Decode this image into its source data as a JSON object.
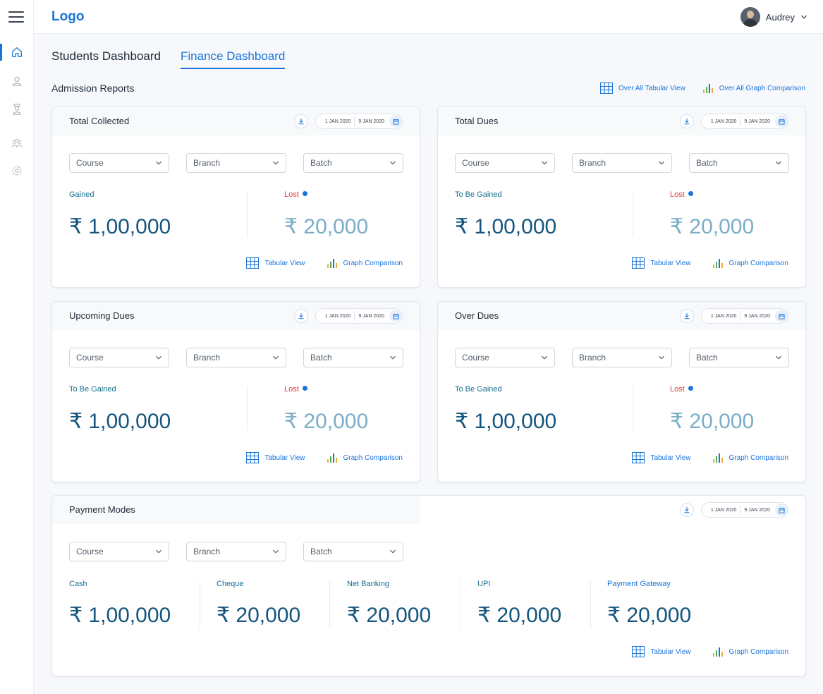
{
  "app": {
    "logo": "Logo",
    "user_name": "Audrey"
  },
  "tabs": [
    "Students Dashboard",
    "Finance Dashboard"
  ],
  "section": {
    "title": "Admission Reports",
    "tabular_all": "Over All Tabular View",
    "graph_all": "Over All Graph Comparison"
  },
  "date_range": {
    "from": "1 JAN 2020",
    "to": "9 JAN 2020"
  },
  "filters": {
    "course": "Course",
    "branch": "Branch",
    "batch": "Batch"
  },
  "links": {
    "tabular": "Tabular View",
    "graph": "Graph Comparison"
  },
  "cards": [
    {
      "title": "Total Collected",
      "left_label": "Gained",
      "left_value": "₹ 1,00,000",
      "right_label": "Lost",
      "right_value": "₹ 20,000"
    },
    {
      "title": "Total Dues",
      "left_label": "To Be Gained",
      "left_value": "₹ 1,00,000",
      "right_label": "Lost",
      "right_value": "₹ 20,000"
    },
    {
      "title": "Upcoming Dues",
      "left_label": "To Be Gained",
      "left_value": "₹ 1,00,000",
      "right_label": "Lost",
      "right_value": "₹ 20,000"
    },
    {
      "title": "Over Dues",
      "left_label": "To Be Gained",
      "left_value": "₹ 1,00,000",
      "right_label": "Lost",
      "right_value": "₹ 20,000"
    }
  ],
  "payment_modes": {
    "title": "Payment Modes",
    "modes": [
      {
        "label": "Cash",
        "value": "₹ 1,00,000"
      },
      {
        "label": "Cheque",
        "value": "₹ 20,000"
      },
      {
        "label": "Net Banking",
        "value": "₹ 20,000"
      },
      {
        "label": "UPI",
        "value": "₹ 20,000"
      },
      {
        "label": "Payment Gateway",
        "value": "₹ 20,000"
      }
    ]
  },
  "colors": {
    "accent": "#1a73d9",
    "value_dark": "#13557e",
    "value_light": "#7aaec7",
    "label_teal": "#166e8e",
    "lost_red": "#e23a3a"
  },
  "icons": [
    "menu-icon",
    "home-icon",
    "user-icon",
    "student-icon",
    "group-icon",
    "settings-icon",
    "chevron-down-icon",
    "download-icon",
    "calendar-icon",
    "table-icon",
    "bar-chart-icon",
    "info-icon"
  ]
}
